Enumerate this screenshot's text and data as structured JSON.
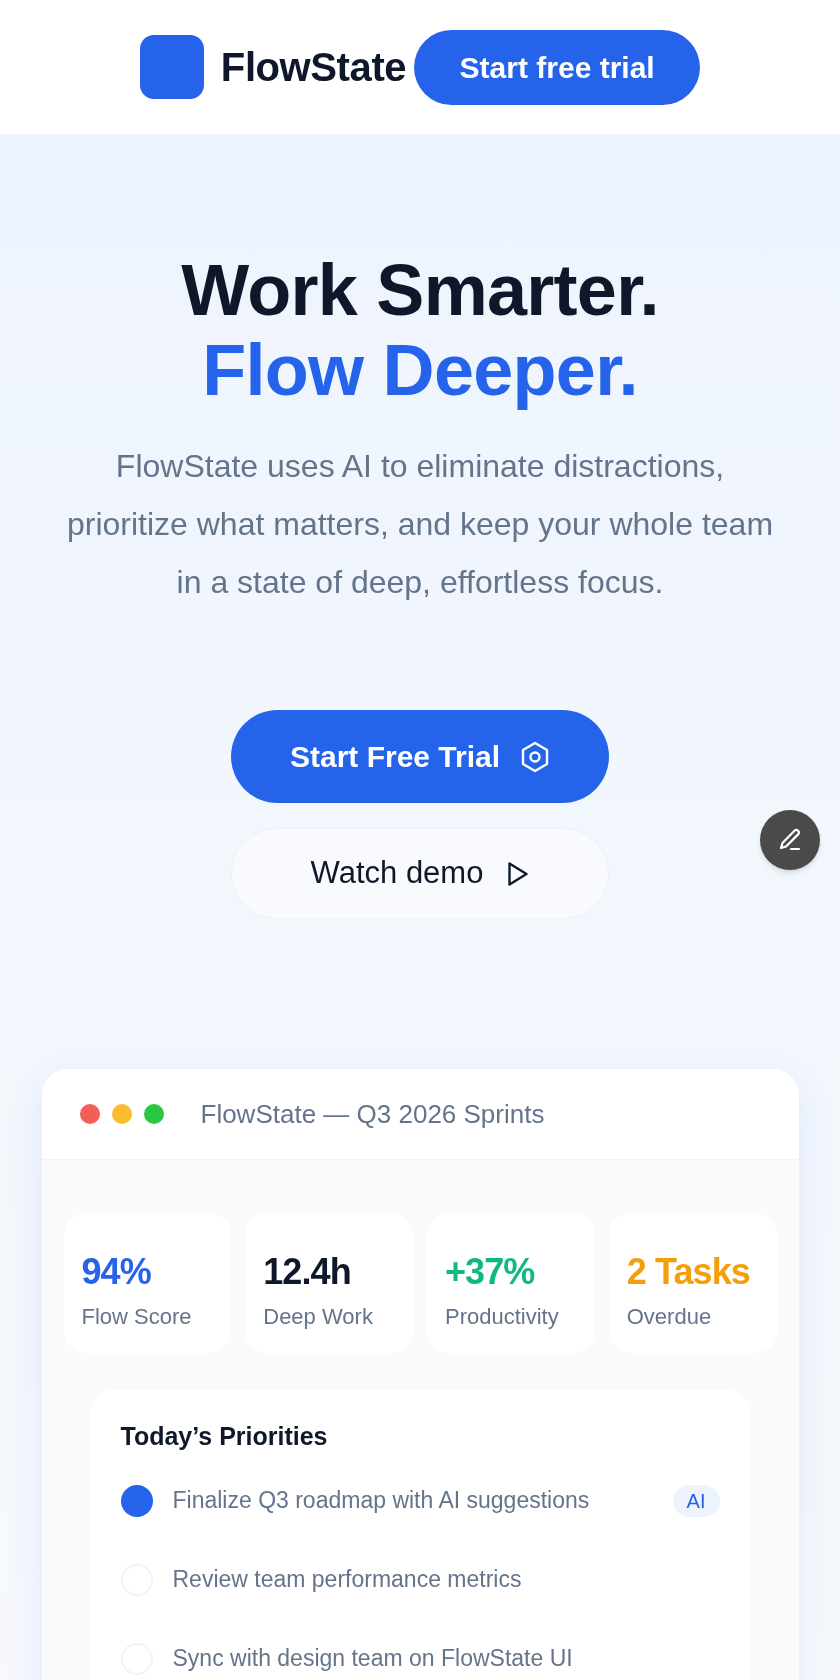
{
  "header": {
    "brand": "FlowState",
    "cta": "Start free trial"
  },
  "hero": {
    "title_line_1": "Work Smarter.",
    "title_line_2": "Flow Deeper.",
    "description": "FlowState uses AI to eliminate distractions, prioritize what matters, and keep your whole team in a state of deep, effortless focus.",
    "primary_button": "Start Free Trial",
    "secondary_button": "Watch demo"
  },
  "dashboard": {
    "title": "FlowState — Q3 2026 Sprints",
    "stats": [
      {
        "value": "94%",
        "label": "Flow Score",
        "color": "#2563eb"
      },
      {
        "value": "12.4h",
        "label": "Deep Work",
        "color": "#0f172a"
      },
      {
        "value": "+37%",
        "label": "Productivity",
        "color": "#10b981"
      },
      {
        "value": "2 Tasks",
        "label": "Overdue",
        "color": "#f59e0b"
      }
    ],
    "priorities": {
      "title": "Today’s Priorities",
      "items": [
        {
          "text": "Finalize Q3 roadmap with AI suggestions",
          "checked": true,
          "badge": "AI"
        },
        {
          "text": "Review team performance metrics",
          "checked": false
        },
        {
          "text": "Sync with design team on FlowState UI",
          "checked": false
        }
      ]
    }
  }
}
